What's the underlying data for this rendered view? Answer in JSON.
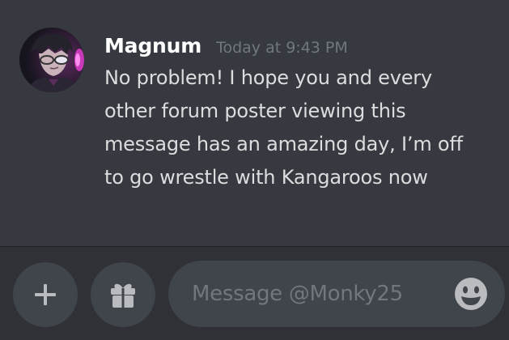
{
  "message": {
    "author": "Magnum",
    "timestamp": "Today at 9:43 PM",
    "text": "No problem! I hope you and every other forum poster viewing this message has an amazing day, I’m off to go wrestle with Kangaroos now"
  },
  "composer": {
    "placeholder": "Message @Monky25",
    "add_icon": "plus-icon",
    "gift_icon": "gift-icon",
    "emoji_icon": "smiley-emoji-icon"
  },
  "colors": {
    "background": "#36393f",
    "composer_bar": "#2f3136",
    "input": "#40444b",
    "username": "#ffffff",
    "timestamp": "#72767d",
    "message_text": "#dcddde",
    "icon": "#b9bbbe"
  }
}
